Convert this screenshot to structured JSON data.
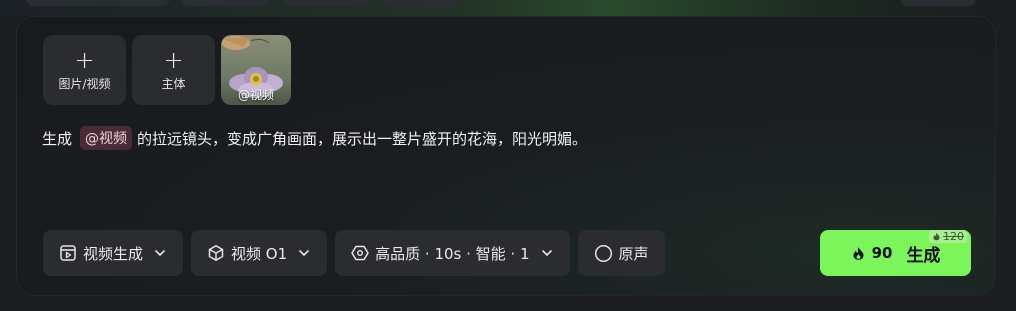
{
  "attachments": {
    "add_media_label": "图片/视频",
    "add_subject_label": "主体",
    "video_ref_tag": "@视频"
  },
  "prompt": {
    "prefix": "生成",
    "mention": "@视频",
    "suffix": "的拉远镜头，变成广角画面，展示出一整片盛开的花海，阳光明媚。"
  },
  "controls": {
    "mode_label": "视频生成",
    "model_label": "视频 O1",
    "settings_label": "高品质 · 10s · 智能 · 1",
    "audio_label": "原声"
  },
  "generate": {
    "cost": "90",
    "label": "生成",
    "old_cost": "120"
  },
  "colors": {
    "accent": "#7cf55a",
    "mention_bg": "#4a2a36",
    "panel_bg": "#1a1d20"
  },
  "icons": {
    "add": "plus-icon",
    "mode": "video-clip-icon",
    "model": "cube-icon",
    "settings": "hexagon-settings-icon",
    "audio": "circle-icon",
    "cost": "flame-icon",
    "dropdown": "chevron-down-icon"
  }
}
